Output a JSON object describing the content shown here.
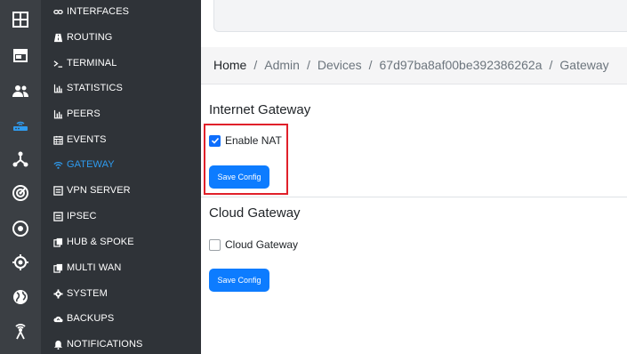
{
  "rail": {
    "items": [
      {
        "icon": "dashboard-grid-icon"
      },
      {
        "icon": "store-icon"
      },
      {
        "icon": "users-icon"
      },
      {
        "icon": "router-icon",
        "active": true
      },
      {
        "icon": "network-topology-icon"
      },
      {
        "icon": "radar-icon"
      },
      {
        "icon": "target-circle-icon"
      },
      {
        "icon": "crosshair-icon"
      },
      {
        "icon": "globe-icon"
      },
      {
        "icon": "broadcast-icon"
      }
    ]
  },
  "nav": {
    "items": [
      {
        "label": "INTERFACES",
        "icon": "link-icon"
      },
      {
        "label": "ROUTING",
        "icon": "road-icon"
      },
      {
        "label": "TERMINAL",
        "icon": "terminal-icon"
      },
      {
        "label": "STATISTICS",
        "icon": "bar-chart-icon"
      },
      {
        "label": "PEERS",
        "icon": "bar-chart-icon"
      },
      {
        "label": "EVENTS",
        "icon": "calendar-icon"
      },
      {
        "label": "GATEWAY",
        "icon": "wifi-icon",
        "active": true
      },
      {
        "label": "VPN SERVER",
        "icon": "server-icon"
      },
      {
        "label": "IPSEC",
        "icon": "server-icon"
      },
      {
        "label": "HUB & SPOKE",
        "icon": "copy-icon"
      },
      {
        "label": "MULTI WAN",
        "icon": "copy-icon"
      },
      {
        "label": "SYSTEM",
        "icon": "gear-icon"
      },
      {
        "label": "BACKUPS",
        "icon": "cloud-upload-icon"
      },
      {
        "label": "NOTIFICATIONS",
        "icon": "bell-icon"
      }
    ]
  },
  "breadcrumb": {
    "items": [
      "Home",
      "Admin",
      "Devices",
      "67d97ba8af00be392386262a",
      "Gateway"
    ],
    "separator": "/"
  },
  "internet_gateway": {
    "title": "Internet Gateway",
    "checkbox_label": "Enable NAT",
    "checked": true,
    "button_label": "Save Config"
  },
  "cloud_gateway": {
    "title": "Cloud Gateway",
    "checkbox_label": "Cloud Gateway",
    "checked": false,
    "button_label": "Save Config"
  },
  "colors": {
    "rail_bg": "#3b3f44",
    "nav_bg": "#2f3338",
    "active": "#2f9cf0",
    "button": "#0d7cff",
    "highlight": "#e0202a"
  }
}
